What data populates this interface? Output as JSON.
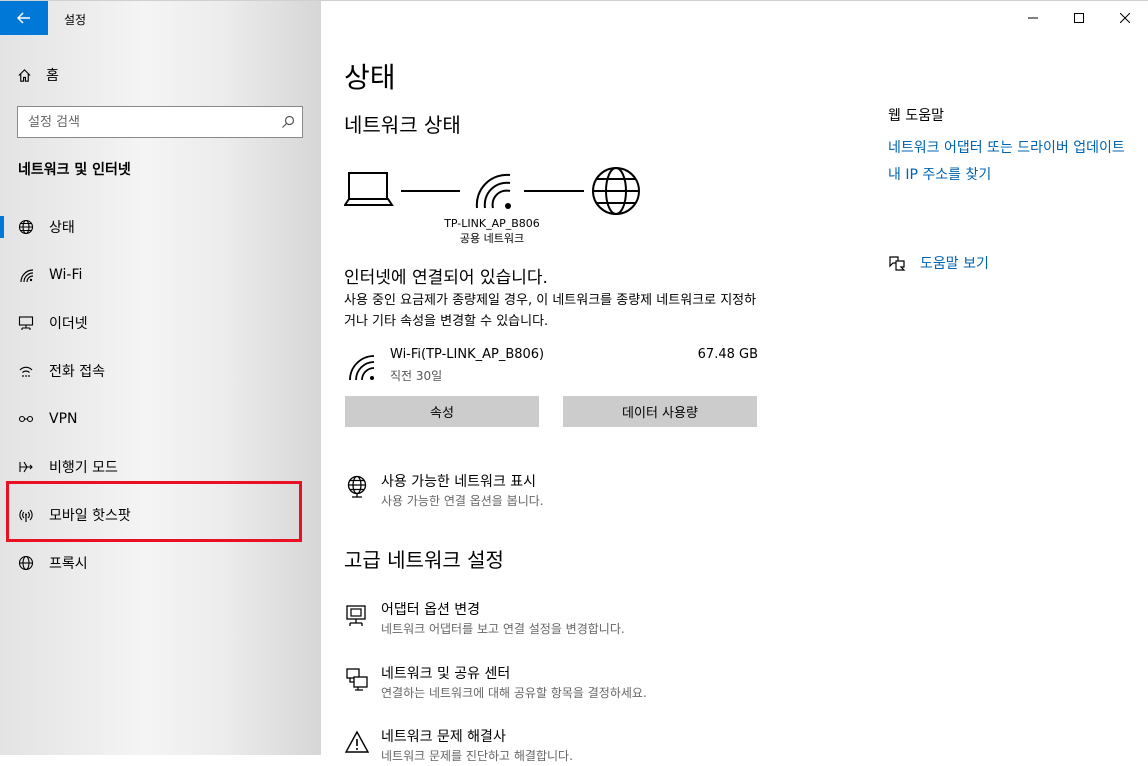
{
  "window": {
    "title": "설정"
  },
  "sidebar": {
    "home_label": "홈",
    "search_placeholder": "설정 검색",
    "section_title": "네트워크 및 인터넷",
    "items": [
      {
        "label": "상태",
        "icon": "globe-icon",
        "active": true
      },
      {
        "label": "Wi-Fi",
        "icon": "wifi-icon"
      },
      {
        "label": "이더넷",
        "icon": "ethernet-icon"
      },
      {
        "label": "전화 접속",
        "icon": "dialup-icon"
      },
      {
        "label": "VPN",
        "icon": "vpn-icon"
      },
      {
        "label": "비행기 모드",
        "icon": "airplane-icon"
      },
      {
        "label": "모바일 핫스팟",
        "icon": "hotspot-icon",
        "highlighted": true
      },
      {
        "label": "프록시",
        "icon": "globe-icon"
      }
    ]
  },
  "main": {
    "page_title": "상태",
    "network_status_title": "네트워크 상태",
    "network_name": "TP-LINK_AP_B806",
    "network_type": "공용 네트워크",
    "connection_status": "인터넷에 연결되어 있습니다.",
    "connection_description": "사용 중인 요금제가 종량제일 경우, 이 네트워크를 종량제 네트워크로 지정하거나 기타 속성을 변경할 수 있습니다.",
    "usage": {
      "name": "Wi-Fi(TP-LINK_AP_B806)",
      "period": "직전 30일",
      "amount": "67.48 GB"
    },
    "buttons": {
      "properties": "속성",
      "data_usage": "데이터 사용량"
    },
    "show_networks": {
      "title": "사용 가능한 네트워크 표시",
      "desc": "사용 가능한 연결 옵션을 봅니다."
    },
    "advanced_title": "고급 네트워크 설정",
    "advanced_items": [
      {
        "title": "어댑터 옵션 변경",
        "desc": "네트워크 어댑터를 보고 연결 설정을 변경합니다."
      },
      {
        "title": "네트워크 및 공유 센터",
        "desc": "연결하는 네트워크에 대해 공유할 항목을 결정하세요."
      },
      {
        "title": "네트워크 문제 해결사",
        "desc": "네트워크 문제를 진단하고 해결합니다."
      }
    ]
  },
  "help": {
    "title": "웹 도움말",
    "links": [
      "네트워크 어댑터 또는 드라이버 업데이트",
      "내 IP 주소를 찾기"
    ],
    "see_help": "도움말 보기"
  },
  "colors": {
    "accent": "#0078d7",
    "link": "#0063b1",
    "highlight": "#e81123",
    "button": "#cccccc"
  }
}
